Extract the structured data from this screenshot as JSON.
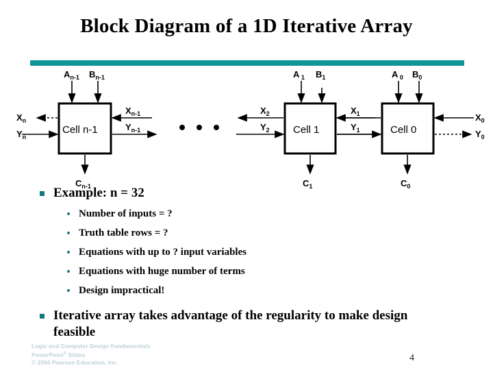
{
  "slide": {
    "title": "Block Diagram of a 1D Iterative Array",
    "page_number": "4",
    "accent_color": "#0f9598",
    "bullet_color": "#12787c",
    "credit_color": "#bcd3d6"
  },
  "diagram": {
    "cells": [
      {
        "name": "Cell n-1",
        "top_labels": [
          "A",
          "n-1",
          "B",
          "n-1"
        ],
        "top_label_a": "A",
        "top_label_a_sub": "n-1",
        "top_label_b": "B",
        "top_label_b_sub": "n-1",
        "left_out": "X",
        "left_out_sub": "n",
        "left_in": "Y",
        "left_in_sub": "n",
        "right_in": "X",
        "right_in_sub": "n-1",
        "right_out": "Y",
        "right_out_sub": "n-1",
        "carry": "C",
        "carry_sub": "n-1"
      },
      {
        "name": "Cell 1",
        "top_label_a": "A",
        "top_label_a_sub": "1",
        "top_label_b": "B",
        "top_label_b_sub": "1",
        "left_out": "X",
        "left_out_sub": "2",
        "left_in": "Y",
        "left_in_sub": "2",
        "right_in": "X",
        "right_in_sub": "1",
        "right_out": "Y",
        "right_out_sub": "1",
        "carry": "C",
        "carry_sub": "1"
      },
      {
        "name": "Cell 0",
        "top_label_a": "A",
        "top_label_a_sub": "0",
        "top_label_b": "B",
        "top_label_b_sub": "0",
        "right_in": "X",
        "right_in_sub": "0",
        "right_out": "Y",
        "right_out_sub": "0",
        "carry": "C",
        "carry_sub": "0"
      }
    ],
    "ellipsis": "• • •"
  },
  "content": {
    "bullets": [
      {
        "level": 1,
        "text": "Example: n = 32",
        "children": [
          {
            "level": 2,
            "text": "Number of inputs = ?"
          },
          {
            "level": 2,
            "text": "Truth table rows =  ?"
          },
          {
            "level": 2,
            "text": "Equations with  up to ?  input variables"
          },
          {
            "level": 2,
            "text": "Equations with huge number of terms"
          },
          {
            "level": 2,
            "text": "Design impractical!"
          }
        ]
      },
      {
        "level": 1,
        "text": "Iterative array takes advantage of the regularity to make design feasible",
        "children": []
      }
    ]
  },
  "footer": {
    "line1": "Logic and Computer Design Fundamentals",
    "line2_pre": "PowerPoint",
    "line2_sup": "®",
    "line2_post": " Slides",
    "line3": "© 2004 Pearson Education, Inc."
  }
}
